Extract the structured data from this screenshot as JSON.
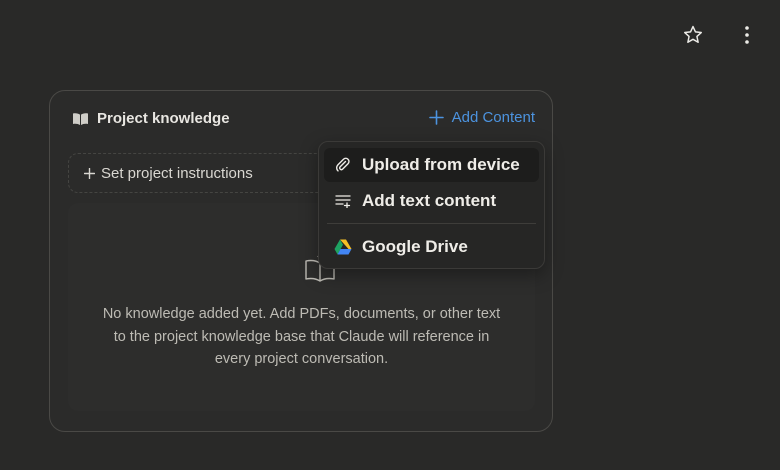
{
  "header": {
    "star_icon": "star-icon",
    "more_icon": "more-vertical-icon"
  },
  "knowledge": {
    "title": "Project knowledge",
    "title_icon": "book-icon",
    "add_content_label": "Add Content",
    "instructions_label": "Set project instructions",
    "empty_message": "No knowledge added yet. Add PDFs, documents, or other text to the project knowledge base that Claude will reference in every project conversation.",
    "empty_icon": "open-book-icon"
  },
  "dropdown": {
    "items": [
      {
        "label": "Upload from device",
        "icon": "paperclip-icon"
      },
      {
        "label": "Add text content",
        "icon": "text-lines-icon"
      },
      {
        "label": "Google Drive",
        "icon": "google-drive-icon"
      }
    ]
  },
  "colors": {
    "background": "#292928",
    "accent": "#4c93df",
    "menu_bg": "#262625"
  }
}
